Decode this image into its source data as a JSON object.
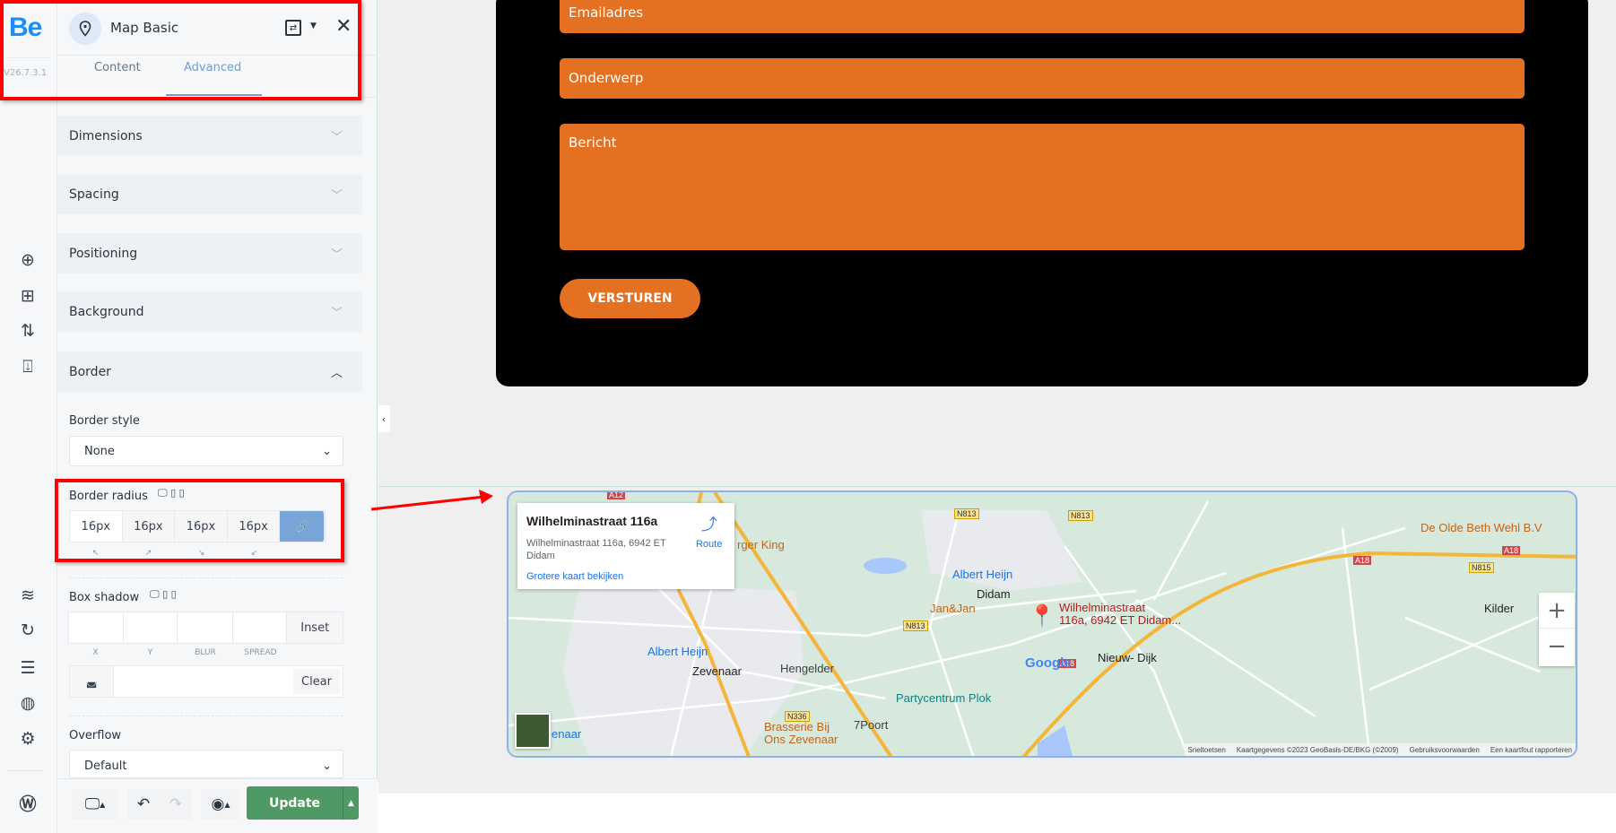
{
  "rail": {
    "logo": "Be",
    "version": "V26.7.3.1",
    "icons": [
      "plus-circle-icon",
      "add-section-icon",
      "sort-icon",
      "import-icon",
      "layers-icon",
      "history-icon",
      "sliders-icon",
      "globe-icon",
      "gear-icon",
      "wordpress-icon"
    ]
  },
  "panel": {
    "title": "Map Basic",
    "tabs": [
      {
        "label": "Content",
        "active": false
      },
      {
        "label": "Advanced",
        "active": true
      }
    ],
    "sections": [
      "Dimensions",
      "Spacing",
      "Positioning",
      "Background",
      "Border"
    ],
    "border": {
      "style_label": "Border style",
      "style_value": "None",
      "radius_label": "Border radius",
      "radius_values": [
        "16px",
        "16px",
        "16px",
        "16px"
      ],
      "radius_corners": [
        "↖",
        "↗",
        "↘",
        "↙"
      ],
      "shadow_label": "Box shadow",
      "shadow_inset": "Inset",
      "shadow_fields": [
        "X",
        "Y",
        "BLUR",
        "SPREAD"
      ],
      "shadow_clear": "Clear",
      "overflow_label": "Overflow",
      "overflow_value": "Default"
    },
    "update_label": "Update"
  },
  "form": {
    "fields": [
      "Emailadres",
      "Onderwerp",
      "Bericht"
    ],
    "submit": "VERSTUREN",
    "accent": "#e47021"
  },
  "map": {
    "card": {
      "title": "Wilhelminastraat 116a",
      "address": "Wilhelminastraat 116a, 6942 ET Didam",
      "route": "Route",
      "link": "Grotere kaart bekijken"
    },
    "places": {
      "didam": "Didam",
      "zevenaar": "Zevenaar",
      "nieuwdijk": "Nieuw- Dijk",
      "kilder": "Kilder",
      "ah1": "Albert Heijn",
      "ah2": "Albert Heijn",
      "janjan": "Jan&Jan",
      "bk": "rger King",
      "hengelder": "Hengelder",
      "plok": "Partycentrum Plok",
      "poort": "7Poort",
      "brasserie1": "Brasserie Bij",
      "brasserie2": "Ons Zevenaar",
      "olde": "De Olde Beth Wehl B.V",
      "pin1": "Wilhelminastraat",
      "pin2": "116a, 6942 ET Didam...",
      "enaar": "enaar"
    },
    "roads": {
      "n813a": "N813",
      "n813b": "N813",
      "n813c": "N813",
      "n336": "N336",
      "n815": "N815",
      "a18a": "A18",
      "a18b": "A18",
      "a18c": "A18",
      "a12": "A12"
    },
    "footer": [
      "Sneltoetsen",
      "Kaartgegevens ©2023 GeoBasis-DE/BKG (©2009)",
      "Gebruiksvoorwaarden",
      "Een kaartfout rapporteren"
    ],
    "google": "Google",
    "zoom_in": "+",
    "zoom_out": "−"
  }
}
